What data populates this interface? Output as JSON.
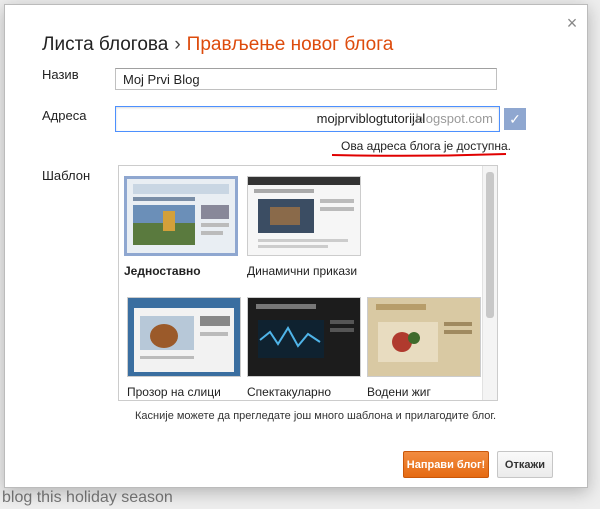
{
  "background": {
    "footer_text": "blog this holiday season"
  },
  "dialog": {
    "title_main": "Листа блогова",
    "title_separator": "›",
    "title_sub": "Прављење новог блога",
    "close_glyph": "×",
    "name_label": "Назив",
    "name_value": "Moj Prvi Blog",
    "address_label": "Адреса",
    "address_value": "mojprviblogtutorijal",
    "address_suffix": ".blogspot.com",
    "check_glyph": "✓",
    "availability": "Ова адреса блога је доступна.",
    "template_label": "Шаблон",
    "templates": [
      {
        "name": "Једноставно",
        "selected": true
      },
      {
        "name": "Динамични прикази",
        "selected": false
      },
      {
        "name": "Прозор на слици",
        "selected": false
      },
      {
        "name": "Спектакуларно",
        "selected": false
      },
      {
        "name": "Водени жиг",
        "selected": false
      }
    ],
    "hint": "Касније можете да прегледате још много шаблона и прилагодите блог.",
    "create_button": "Направи блог!",
    "cancel_button": "Откажи"
  },
  "colors": {
    "accent_orange": "#dd4b0c",
    "selected_border": "#8fa7d0",
    "underline_red": "#e00000"
  }
}
